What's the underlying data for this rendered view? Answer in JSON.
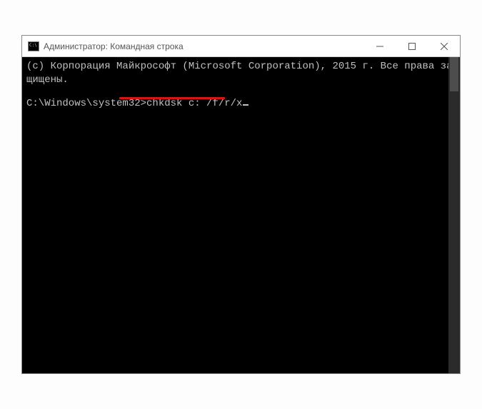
{
  "window": {
    "title": "Администратор: Командная строка"
  },
  "terminal": {
    "copyright_line": "(c) Корпорация Майкрософт (Microsoft Corporation), 2015 г. Все права защищены.",
    "prompt": "C:\\Windows\\system32>",
    "command": "chkdsk c: /f/r/x"
  }
}
